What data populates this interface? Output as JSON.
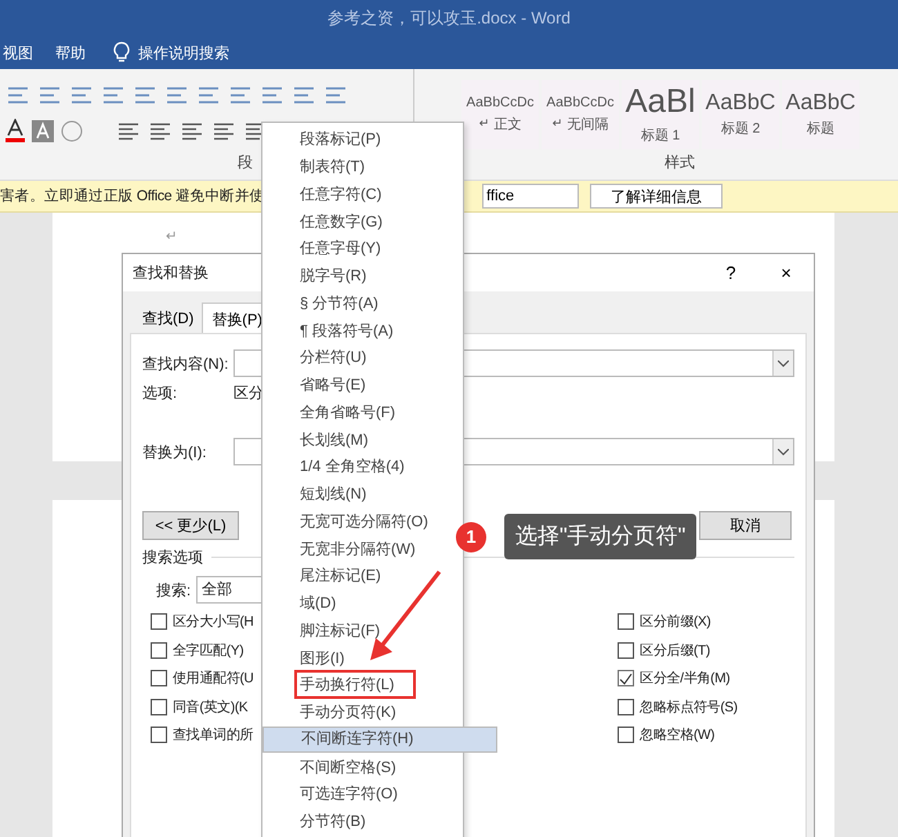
{
  "window": {
    "title": "参考之资，可以攻玉.docx  -  Word"
  },
  "menu_bar": [
    "视图",
    "帮助"
  ],
  "tell_me": "操作说明搜索",
  "ribbon": {
    "groups": [
      {
        "label": "段"
      },
      {
        "label": "样式"
      }
    ],
    "styles": [
      {
        "preview": "AaBbCcDc",
        "mark": "↵",
        "name": "正文",
        "kind": "plain"
      },
      {
        "preview": "AaBbCcDc",
        "mark": "↵",
        "name": "无间隔",
        "kind": "plain"
      },
      {
        "preview": "AaBl",
        "name": "标题 1",
        "kind": "heading1"
      },
      {
        "preview": "AaBbC",
        "name": "标题 2",
        "kind": "heading2"
      },
      {
        "preview": "AaBbC",
        "name": "标题",
        "kind": "heading2"
      }
    ]
  },
  "notice_bar": {
    "text": "害者。立即通过正版 Office 避免中断并使",
    "buttons": [
      "ffice",
      "了解详细信息"
    ]
  },
  "document": {
    "paragraph_mark": "↵"
  },
  "dialog": {
    "title": "查找和替换",
    "help": "?",
    "close": "×",
    "tabs": [
      {
        "label": "查找(D)",
        "selected": false
      },
      {
        "label": "替换(P)",
        "selected": true
      }
    ],
    "find_label": "查找内容(N):",
    "options_label": "选项:",
    "options_value": "区分",
    "replace_label": "替换为(I):",
    "less_button": "<< 更少(L)",
    "cancel_button": "取消",
    "search_options_label": "搜索选项",
    "search_label": "搜索:",
    "search_value": "全部",
    "left_options": [
      {
        "label": "区分大小写(H",
        "checked": false
      },
      {
        "label": "全字匹配(Y)",
        "checked": false
      },
      {
        "label": "使用通配符(U",
        "checked": false
      },
      {
        "label": "同音(英文)(K",
        "checked": false
      },
      {
        "label": "查找单词的所",
        "checked": false
      }
    ],
    "right_options": [
      {
        "label": "区分前缀(X)",
        "checked": false
      },
      {
        "label": "区分后缀(T)",
        "checked": false
      },
      {
        "label": "区分全/半角(M)",
        "checked": true
      },
      {
        "label": "忽略标点符号(S)",
        "checked": false
      },
      {
        "label": "忽略空格(W)",
        "checked": false
      }
    ]
  },
  "special_menu": {
    "items": [
      {
        "label": "段落标记(P)",
        "selected": false,
        "boxed": false
      },
      {
        "label": "制表符(T)",
        "selected": false,
        "boxed": false
      },
      {
        "label": "任意字符(C)",
        "selected": false,
        "boxed": false
      },
      {
        "label": "任意数字(G)",
        "selected": false,
        "boxed": false
      },
      {
        "label": "任意字母(Y)",
        "selected": false,
        "boxed": false
      },
      {
        "label": "脱字号(R)",
        "selected": false,
        "boxed": false
      },
      {
        "label": "§ 分节符(A)",
        "selected": false,
        "boxed": false
      },
      {
        "label": "¶ 段落符号(A)",
        "selected": false,
        "boxed": false
      },
      {
        "label": "分栏符(U)",
        "selected": false,
        "boxed": false
      },
      {
        "label": "省略号(E)",
        "selected": false,
        "boxed": false
      },
      {
        "label": "全角省略号(F)",
        "selected": false,
        "boxed": false
      },
      {
        "label": "长划线(M)",
        "selected": false,
        "boxed": false
      },
      {
        "label": "1/4 全角空格(4)",
        "selected": false,
        "boxed": false
      },
      {
        "label": "短划线(N)",
        "selected": false,
        "boxed": false
      },
      {
        "label": "无宽可选分隔符(O)",
        "selected": false,
        "boxed": false
      },
      {
        "label": "无宽非分隔符(W)",
        "selected": false,
        "boxed": false
      },
      {
        "label": "尾注标记(E)",
        "selected": false,
        "boxed": false
      },
      {
        "label": "域(D)",
        "selected": false,
        "boxed": false
      },
      {
        "label": "脚注标记(F)",
        "selected": false,
        "boxed": false
      },
      {
        "label": "图形(I)",
        "selected": false,
        "boxed": false
      },
      {
        "label": "手动换行符(L)",
        "selected": false,
        "boxed": true
      },
      {
        "label": "手动分页符(K)",
        "selected": false,
        "boxed": false
      },
      {
        "label": "不间断连字符(H)",
        "selected": true,
        "boxed": false
      },
      {
        "label": "不间断空格(S)",
        "selected": false,
        "boxed": false
      },
      {
        "label": "可选连字符(O)",
        "selected": false,
        "boxed": false
      },
      {
        "label": "分节符(B)",
        "selected": false,
        "boxed": false
      }
    ]
  },
  "callout": {
    "number": "1",
    "text": "选择\"手动分页符\""
  }
}
